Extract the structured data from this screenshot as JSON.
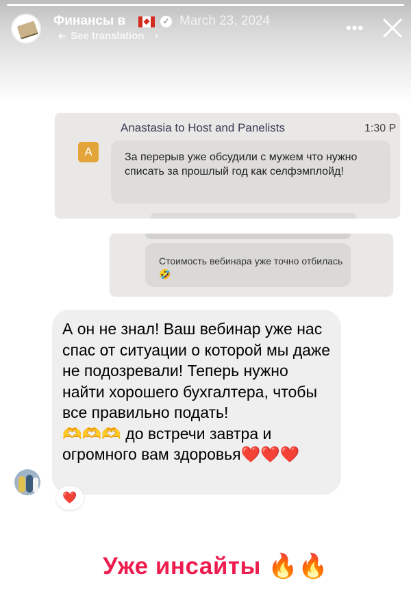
{
  "story": {
    "account_name": "Финансы в",
    "date": "March 23, 2024",
    "translate_label": "See translation",
    "more_label": "•••",
    "progress": 1.0
  },
  "screenshot1": {
    "header": "Anastasia to Host and Panelists",
    "time": "1:30 P",
    "avatar_letter": "A",
    "message": "За перерыв уже обсудили с мужем что нужно списать за прошлый год как селфэмплойд!"
  },
  "screenshot2": {
    "message": "Стоимость вебинара уже точно отбилась🤣"
  },
  "message": {
    "text": "А он не знал! Ваш вебинар уже нас спас от ситуации о которой мы даже не подозревали! Теперь нужно найти хорошего бухгалтера, чтобы все правильно подать!\n🫶🫶🫶 до встречи завтра и огромного вам здоровья❤️❤️❤️",
    "reaction": "❤️"
  },
  "caption": "Уже инсайты 🔥🔥",
  "colors": {
    "caption": "#ee1d4f",
    "bubble": "#efefef",
    "avatar_letter_bg": "#e3a43a"
  },
  "icons": {
    "close": "close-icon",
    "more": "more-icon",
    "verified": "verified-badge-icon",
    "flag": "canada-flag-icon",
    "translate": "translate-icon"
  }
}
